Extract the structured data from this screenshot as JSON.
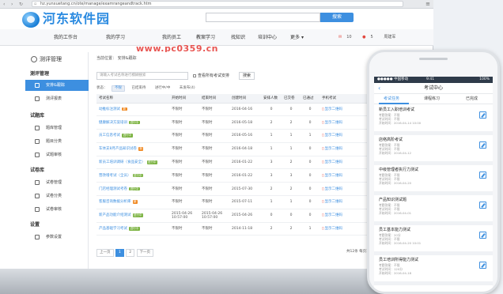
{
  "browser": {
    "url": "hz.yunxuetang.cn/ote/manage/examrangeandtrack.htm",
    "back_glyph": "‹",
    "forward_glyph": "›",
    "reload_glyph": "↻",
    "menu_glyph": "≡"
  },
  "header": {
    "logo_text": "河东软件园",
    "search_placeholder": "",
    "search_button": "搜索"
  },
  "topnav": {
    "items": [
      "我的工作台",
      "我的学习",
      "我的员工",
      "教案学习",
      "找知识",
      "培训中心",
      "更多"
    ],
    "more_caret": "▾",
    "badge_a": "10",
    "badge_b": "5",
    "user": "周建军",
    "watermark": "www.pc0359.cn"
  },
  "sidebar": {
    "title": "测评管理",
    "sections": [
      {
        "label": "测评管理",
        "items": [
          "安排&跟踪",
          "测评报表"
        ]
      },
      {
        "label": "试题库",
        "items": [
          "题库管理",
          "题目分类",
          "试题审核"
        ]
      },
      {
        "label": "试卷库",
        "items": [
          "试卷管理",
          "试卷分类",
          "试卷审核"
        ]
      },
      {
        "label": "设置",
        "items": [
          "参数设置"
        ]
      }
    ]
  },
  "main": {
    "crumb": "当前位置：  安排&跟踪",
    "filter_placeholder": "请输入考试名称进行模糊搜索",
    "filter_check": "查看所有考试安排",
    "filter_button": "搜索",
    "status_label": "状态：",
    "status_tags": [
      "不限",
      "已结束待",
      "进行中/中",
      "未发布(4)"
    ],
    "columns": [
      "考试名称",
      "开始时间",
      "结束时间",
      "创建时间",
      "安排人数",
      "已交卷",
      "已通过",
      "手机考试"
    ],
    "rows": [
      {
        "name": "动推标注测试",
        "badge": "新",
        "badge_color": "#f08a24",
        "start": "不限时",
        "end": "不限时",
        "created": "2016-04-16",
        "arranged": "0",
        "submitted": "0",
        "passed": "0",
        "mobile": "显示二维码"
      },
      {
        "name": "健康解决方案培训",
        "badge": "进行中",
        "badge_color": "#7cb342",
        "start": "不限时",
        "end": "不限时",
        "created": "2016-05-18",
        "arranged": "2",
        "submitted": "2",
        "passed": "0",
        "mobile": "显示二维码"
      },
      {
        "name": "员工信息考试",
        "badge": "进行中",
        "badge_color": "#7cb342",
        "start": "不限时",
        "end": "不限时",
        "created": "2016-05-16",
        "arranged": "1",
        "submitted": "1",
        "passed": "1",
        "mobile": "显示二维码"
      },
      {
        "name": "车体支8月产品知识试卷",
        "badge": "新",
        "badge_color": "#f08a24",
        "start": "不限时",
        "end": "不限时",
        "created": "2016-04-18",
        "arranged": "1",
        "submitted": "1",
        "passed": "0",
        "mobile": "显示二维码"
      },
      {
        "name": "新员工培训调研（食品安全）",
        "badge": "进行中",
        "badge_color": "#7cb342",
        "start": "不限时",
        "end": "不限时",
        "created": "2016-01-22",
        "arranged": "3",
        "submitted": "2",
        "passed": "0",
        "mobile": "显示二维码"
      },
      {
        "name": "营改增考试（全员）",
        "badge": "进行中",
        "badge_color": "#7cb342",
        "start": "不限时",
        "end": "不限时",
        "created": "2016-01-22",
        "arranged": "3",
        "submitted": "3",
        "passed": "0",
        "mobile": "显示二维码"
      },
      {
        "name": "门店经理测试考卷",
        "badge": "进行中",
        "badge_color": "#7cb342",
        "start": "不限时",
        "end": "不限时",
        "created": "2015-07-30",
        "arranged": "2",
        "submitted": "2",
        "passed": "0",
        "mobile": "显示二维码"
      },
      {
        "name": "客服咨询数据分析库",
        "badge": "新",
        "badge_color": "#f08a24",
        "start": "不限时",
        "end": "不限时",
        "created": "2015-07-11",
        "arranged": "1",
        "submitted": "1",
        "passed": "0",
        "mobile": "显示二维码"
      },
      {
        "name": "新产品功能介绍测试",
        "badge": "进行中",
        "badge_color": "#7cb342",
        "start": "2015-04-26\n10:57:00",
        "end": "2015-04-26\n10:57:00",
        "created": "2015-04-26",
        "arranged": "0",
        "submitted": "0",
        "passed": "0",
        "mobile": "显示二维码"
      },
      {
        "name": "产品基础学习考试",
        "badge": "进行中",
        "badge_color": "#7cb342",
        "start": "不限时",
        "end": "不限时",
        "created": "2014-11-18",
        "arranged": "2",
        "submitted": "2",
        "passed": "1",
        "mobile": "显示二维码"
      }
    ],
    "pager": {
      "prev": "上一页",
      "pages": [
        "1",
        "2"
      ],
      "next": "下一页",
      "total": "共12条 每页10条"
    }
  },
  "phone": {
    "status_left": "●●●●● 中国移动",
    "status_time": "9:41",
    "status_right": "100%",
    "back": "‹",
    "title": "考试中心",
    "tabs": [
      "考试任务",
      "课程练习",
      "已完成"
    ],
    "items": [
      {
        "title": "新员工入职培训考试",
        "meta": [
          "考题答案：不限",
          "考试时间：不限",
          "开始时间：2016-04-14 10:00"
        ]
      },
      {
        "title": "店络高阶考试",
        "meta": [
          "考题答案：不限",
          "考试时间：不限",
          "开始时间：2016-04-12"
        ]
      },
      {
        "title": "中级管理者执行力测试",
        "meta": [
          "考题答案：不限",
          "考试时间：不限",
          "开始时间：2016-04-20"
        ]
      },
      {
        "title": "产品知识测试题",
        "meta": [
          "考题答案：不限",
          "考试时间：不限",
          "开始时间：2016-04-01"
        ]
      },
      {
        "title": "员工基本能力测试",
        "meta": [
          "考题答案：20分",
          "考试时间：不限",
          "开始时间：2016-04-20 10:01"
        ]
      },
      {
        "title": "员工培训所得能力测试",
        "meta": [
          "考题答案：不限",
          "考试时间：120分",
          "开始时间：2016-04-18"
        ]
      }
    ]
  }
}
